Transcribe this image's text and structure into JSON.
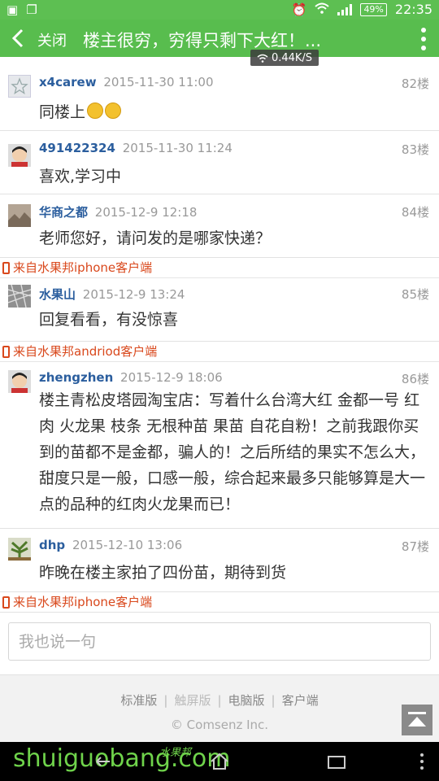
{
  "status_bar": {
    "battery": "49%",
    "time": "22:35"
  },
  "header": {
    "close_label": "关闭",
    "title": "楼主很穷，穷得只剩下大红！..."
  },
  "network_speed": "0.44K/S",
  "posts": [
    {
      "author": "x4carew",
      "date": "2015-11-30 11:00",
      "floor": "82楼",
      "content": "同楼上",
      "emoji_count": 2
    },
    {
      "author": "491422324",
      "date": "2015-11-30 11:24",
      "floor": "83楼",
      "content": "喜欢,学习中"
    },
    {
      "author": "华商之都",
      "date": "2015-12-9 12:18",
      "floor": "84楼",
      "content": "老师您好，请问发的是哪家快递？",
      "source": "来自水果邦iphone客户端"
    },
    {
      "author": "水果山",
      "date": "2015-12-9 13:24",
      "floor": "85楼",
      "content": "回复看看，有没惊喜",
      "source": "来自水果邦andriod客户端"
    },
    {
      "author": "zhengzhen",
      "date": "2015-12-9 18:06",
      "floor": "86楼",
      "content": "楼主青松皮塔园淘宝店：写着什么台湾大红 金都一号 红肉 火龙果 枝条 无根种苗 果苗 自花自粉！之前我跟你买到的苗都不是金都，骗人的！之后所结的果实不怎么大，甜度只是一般，口感一般，综合起来最多只能够算是大一点的品种的红肉火龙果而已！"
    },
    {
      "author": "dhp",
      "date": "2015-12-10 13:06",
      "floor": "87楼",
      "content": "昨晚在楼主家拍了四份苗，期待到货",
      "source": "来自水果邦iphone客户端"
    }
  ],
  "reply": {
    "placeholder": "我也说一句"
  },
  "footer": {
    "links": [
      "标准版",
      "触屏版",
      "电脑版",
      "客户端"
    ],
    "copyright": "© Comsenz Inc."
  },
  "watermark": {
    "text": "shuiguobang.com",
    "cn": "水果邦"
  },
  "colors": {
    "header": "#58bd4e",
    "author": "#2b5e9e",
    "source": "#d9481c"
  }
}
